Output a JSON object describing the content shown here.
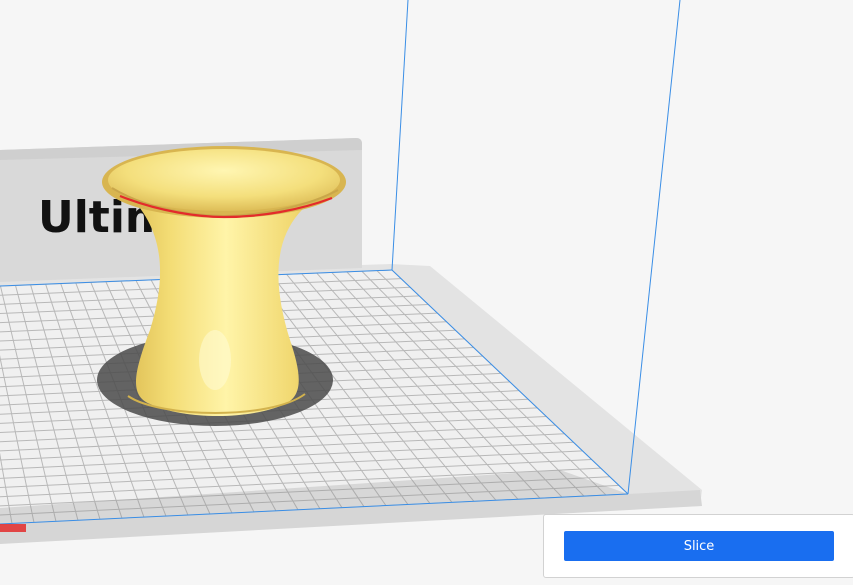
{
  "scene": {
    "backplate_logo_text": "Ultim",
    "model_name": "hourglass-vase",
    "colors": {
      "background": "#f6f6f6",
      "model": "#f5e07a",
      "overhang": "#e32b2b",
      "build_volume_line": "#3a8ee6",
      "grid_line": "#bdbdbd",
      "plate": "#e6e6e6"
    }
  },
  "action_panel": {
    "slice_label": "Slice",
    "accent_color": "#196ef0"
  }
}
